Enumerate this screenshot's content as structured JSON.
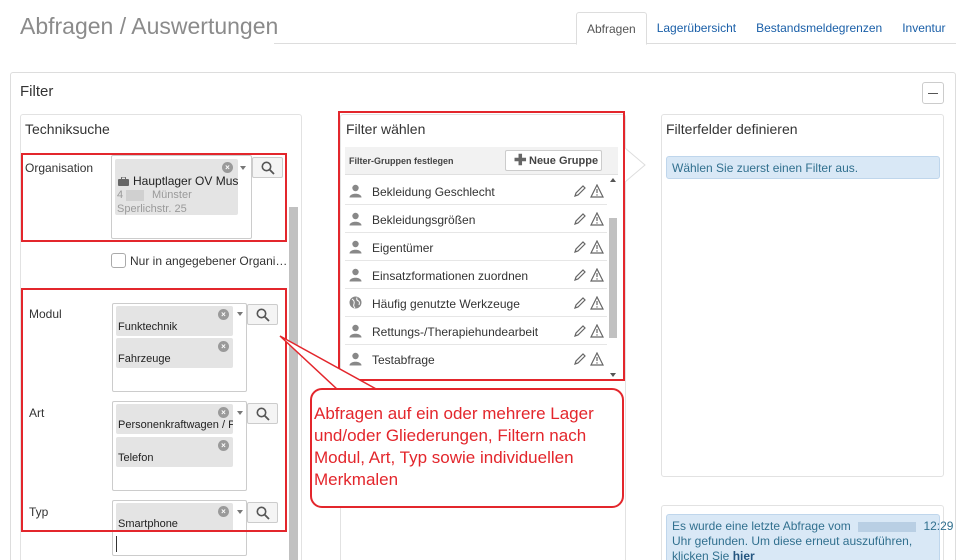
{
  "header": {
    "title": "Abfragen / Auswertungen",
    "tabs": [
      {
        "label": "Abfragen",
        "active": true
      },
      {
        "label": "Lagerübersicht",
        "active": false
      },
      {
        "label": "Bestandsmeldegrenzen",
        "active": false
      },
      {
        "label": "Inventur",
        "active": false
      }
    ]
  },
  "filter": {
    "heading": "Filter",
    "collapse_icon": "minus-icon"
  },
  "techniksuche": {
    "title": "Techniksuche",
    "organisation": {
      "label": "Organisation",
      "chip_icon": "briefcase-icon",
      "chip_line1": "Hauptlager OV Muste",
      "chip_line2_prefix": "4",
      "chip_line2_city": "Münster",
      "chip_line3": "Sperlichstr. 25"
    },
    "only_org_checkbox": {
      "label": "Nur in angegebener Organi…",
      "checked": false
    },
    "modul": {
      "label": "Modul",
      "chips": [
        "Funktechnik",
        "Fahrzeuge"
      ]
    },
    "art": {
      "label": "Art",
      "chips": [
        "Personenkraftwagen / P",
        "Telefon"
      ]
    },
    "typ": {
      "label": "Typ",
      "chips": [
        "Smartphone"
      ],
      "input_value": ""
    }
  },
  "filter_waehlen": {
    "title": "Filter wählen",
    "groups_label": "Filter-Gruppen festlegen",
    "new_group_label": "Neue Gruppe",
    "groups": [
      {
        "label": "Bekleidung Geschlecht",
        "icon": "user-icon"
      },
      {
        "label": "Bekleidungsgrößen",
        "icon": "user-icon"
      },
      {
        "label": "Eigentümer",
        "icon": "user-icon"
      },
      {
        "label": "Einsatzformationen zuordnen",
        "icon": "user-icon"
      },
      {
        "label": "Häufig genutzte Werkzeuge",
        "icon": "globe-icon"
      },
      {
        "label": "Rettungs-/Therapiehundearbeit",
        "icon": "user-icon"
      },
      {
        "label": "Testabfrage",
        "icon": "user-icon"
      }
    ]
  },
  "filterfelder": {
    "title": "Filterfelder definieren",
    "hint": "Wählen Sie zuerst einen Filter aus."
  },
  "last_query": {
    "text_before": "Es wurde eine letzte Abfrage vom",
    "time": "12:29",
    "text_after": "Uhr gefunden. Um diese erneut auszuführen, klicken Sie",
    "link": "hier"
  },
  "callout": {
    "text": "Abfragen auf ein oder mehrere Lager und/oder Gliederungen, Filtern nach Modul, Art, Typ sowie individuellen Merkmalen"
  },
  "colors": {
    "annotation_red": "#e3262c",
    "link_blue": "#1a5fa8",
    "info_bg": "#d9e8f6",
    "info_text": "#31708f"
  }
}
